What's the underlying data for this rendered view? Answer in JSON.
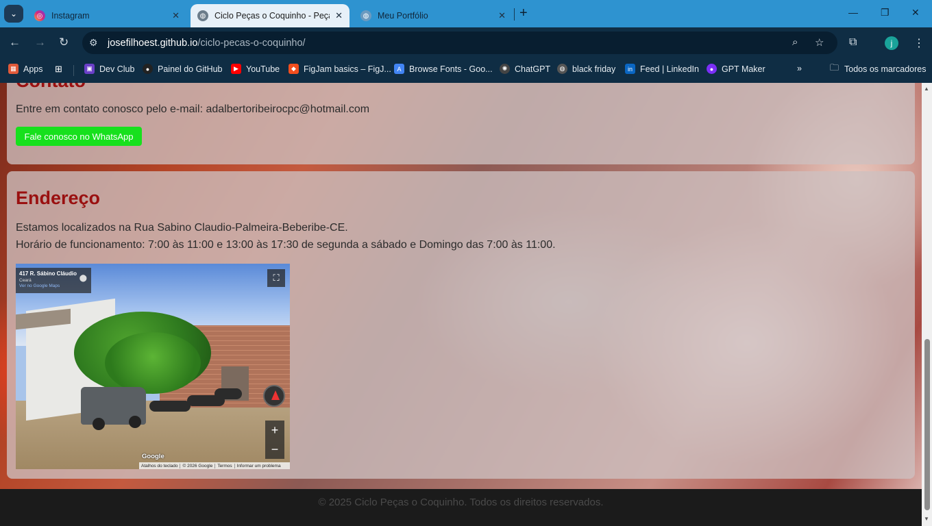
{
  "browser": {
    "tabs": [
      {
        "title": "Instagram",
        "active": false
      },
      {
        "title": "Ciclo Peças o Coquinho - Peças",
        "active": true
      },
      {
        "title": "Meu Portfólio",
        "active": false
      }
    ],
    "url": {
      "host": "josefilhoest.github.io",
      "path": "/ciclo-pecas-o-coquinho/"
    },
    "profile_initial": "j",
    "bookmarks": [
      {
        "label": "Apps",
        "icon": "apps-grid-icon",
        "color": "#e05a3a"
      },
      {
        "label": "Dev Club",
        "icon": "devclub-icon",
        "color": "#6a3fc7"
      },
      {
        "label": "Painel do GitHub",
        "icon": "github-icon",
        "color": "#222222"
      },
      {
        "label": "YouTube",
        "icon": "youtube-icon",
        "color": "#ff0000"
      },
      {
        "label": "FigJam basics – FigJ...",
        "icon": "figma-icon",
        "color": "#f24e1e"
      },
      {
        "label": "Browse Fonts - Goo...",
        "icon": "google-fonts-icon",
        "color": "#4285f4"
      },
      {
        "label": "ChatGPT",
        "icon": "chatgpt-icon",
        "color": "#444444"
      },
      {
        "label": "black friday",
        "icon": "globe-icon",
        "color": "#555555"
      },
      {
        "label": "Feed | LinkedIn",
        "icon": "linkedin-icon",
        "color": "#0a66c2"
      },
      {
        "label": "GPT Maker",
        "icon": "gptmaker-icon",
        "color": "#7b2ff7"
      }
    ],
    "all_bookmarks": "Todos os marcadores"
  },
  "contact": {
    "heading": "Contato",
    "text": "Entre em contato conosco pelo e-mail: adalbertoribeirocpc@hotmail.com",
    "whatsapp_button": "Fale conosco no WhatsApp"
  },
  "address": {
    "heading": "Endereço",
    "line1": "Estamos localizados na Rua Sabino Claudio-Palmeira-Beberibe-CE.",
    "line2": "Horário de funcionamento: 7:00 às 11:00 e 13:00 às 17:30 de segunda a sábado e Domingo das 7:00 às 11:00."
  },
  "map": {
    "place": "417 R. Sábino Cláudio",
    "region": "Ceará",
    "link": "Ver no Google Maps",
    "logo": "Google",
    "footer_links": [
      "Atalhos do teclado",
      "© 2026 Google",
      "Termos",
      "Informar um problema"
    ]
  },
  "footer": {
    "text": "© 2025 Ciclo Peças o Coquinho. Todos os direitos reservados."
  }
}
